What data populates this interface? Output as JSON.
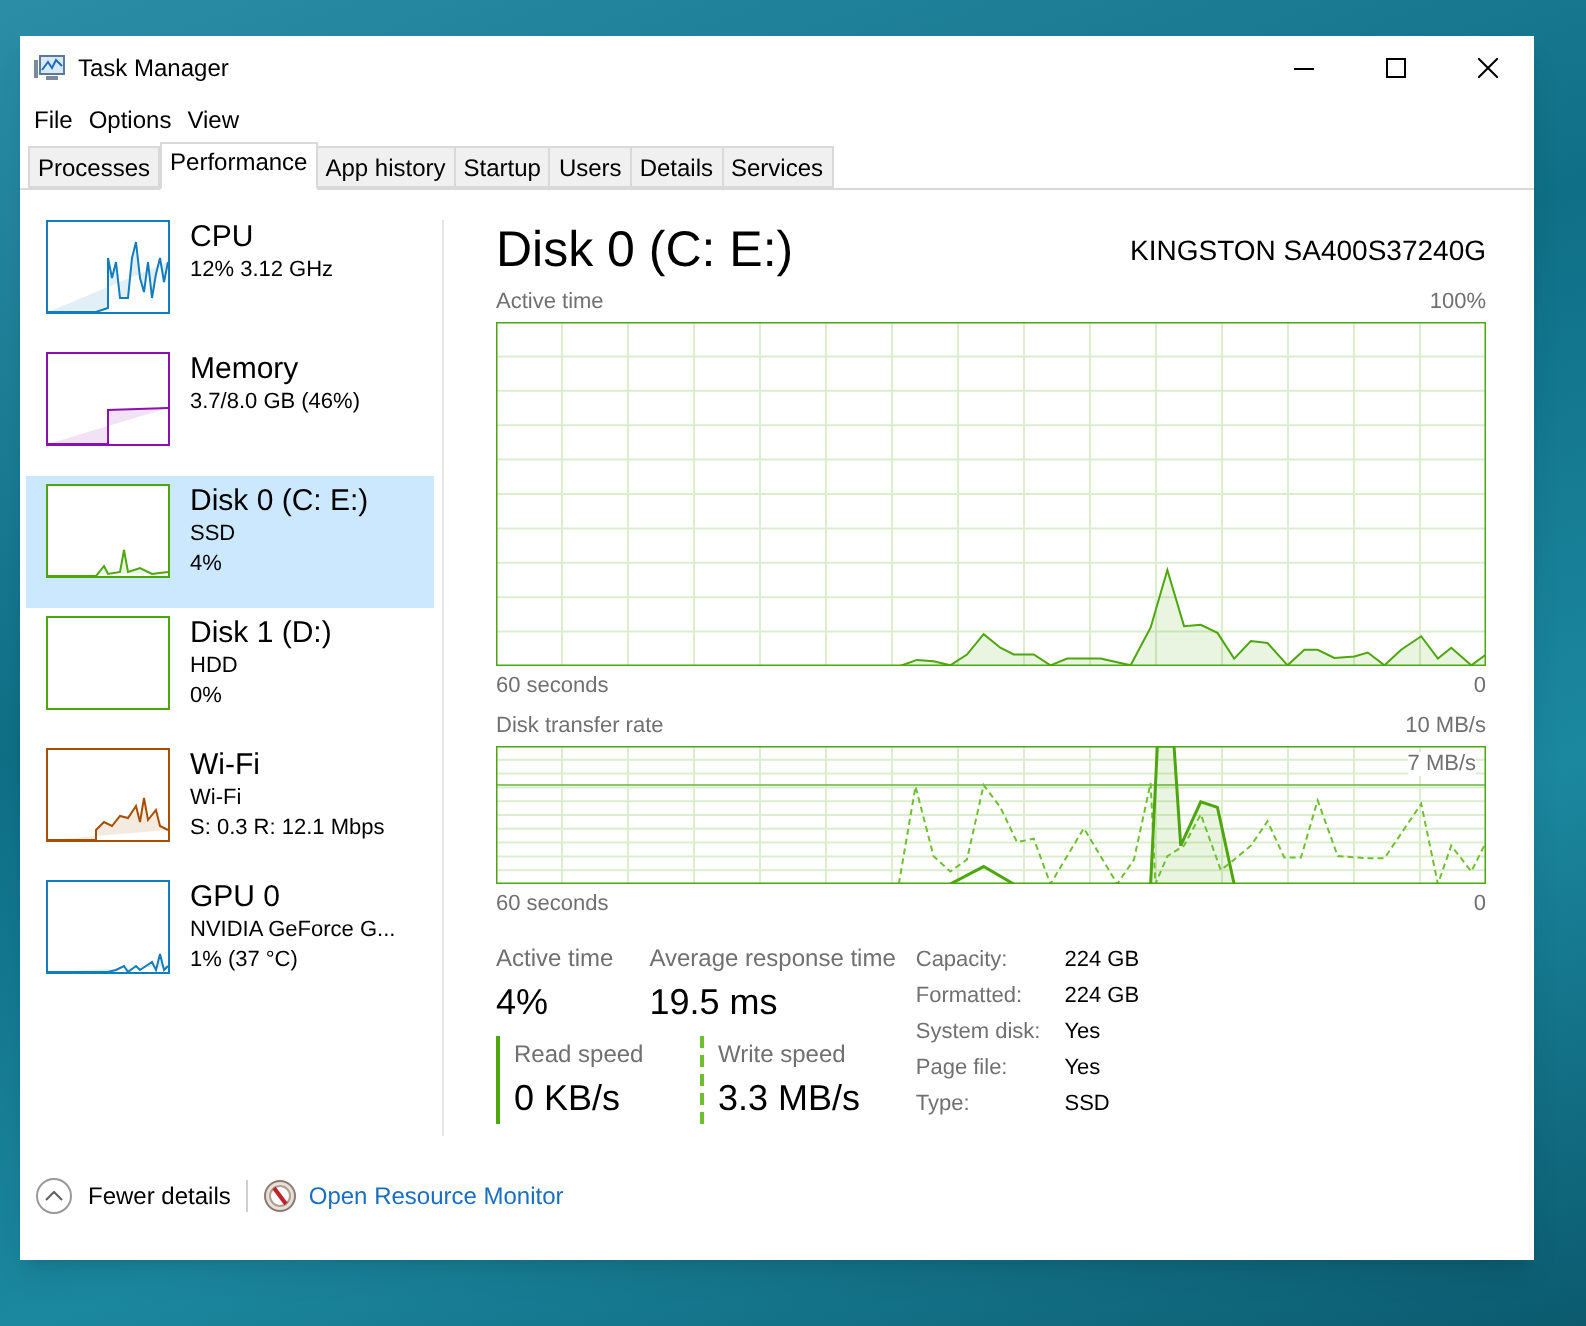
{
  "window": {
    "title": "Task Manager"
  },
  "menu": [
    "File",
    "Options",
    "View"
  ],
  "tabs": [
    {
      "label": "Processes",
      "selected": false
    },
    {
      "label": "Performance",
      "selected": true
    },
    {
      "label": "App history",
      "selected": false
    },
    {
      "label": "Startup",
      "selected": false
    },
    {
      "label": "Users",
      "selected": false
    },
    {
      "label": "Details",
      "selected": false
    },
    {
      "label": "Services",
      "selected": false
    }
  ],
  "sidebar": {
    "items": [
      {
        "name": "CPU",
        "details": [
          "12% 3.12 GHz"
        ],
        "color": "#117dbb",
        "selected": false
      },
      {
        "name": "Memory",
        "details": [
          "3.7/8.0 GB (46%)"
        ],
        "color": "#8b12ae",
        "selected": false
      },
      {
        "name": "Disk 0 (C: E:)",
        "details": [
          "SSD",
          "4%"
        ],
        "color": "#4da60c",
        "selected": true
      },
      {
        "name": "Disk 1 (D:)",
        "details": [
          "HDD",
          "0%"
        ],
        "color": "#4da60c",
        "selected": false
      },
      {
        "name": "Wi-Fi",
        "details": [
          "Wi-Fi",
          "S: 0.3 R: 12.1 Mbps"
        ],
        "color": "#a74f01",
        "selected": false
      },
      {
        "name": "GPU 0",
        "details": [
          "NVIDIA GeForce G...",
          "1% (37 °C)"
        ],
        "color": "#117dbb",
        "selected": false
      }
    ]
  },
  "disk": {
    "title": "Disk 0 (C: E:)",
    "model": "KINGSTON SA400S37240G",
    "active_chart": {
      "label": "Active time",
      "max": "100%",
      "span": "60 seconds",
      "end": "0"
    },
    "transfer_chart": {
      "label": "Disk transfer rate",
      "max": "10 MB/s",
      "marker": "7 MB/s",
      "span": "60 seconds",
      "end": "0"
    },
    "stats": [
      {
        "label": "Active time",
        "value": "4%"
      },
      {
        "label": "Average response time",
        "value": "19.5 ms"
      }
    ],
    "speeds": [
      {
        "label": "Read speed",
        "value": "0 KB/s",
        "kind": "solid"
      },
      {
        "label": "Write speed",
        "value": "3.3 MB/s",
        "kind": "dashed"
      }
    ],
    "properties": [
      {
        "label": "Capacity:",
        "value": "224 GB"
      },
      {
        "label": "Formatted:",
        "value": "224 GB"
      },
      {
        "label": "System disk:",
        "value": "Yes"
      },
      {
        "label": "Page file:",
        "value": "Yes"
      },
      {
        "label": "Type:",
        "value": "SSD"
      }
    ]
  },
  "footer": {
    "fewer_details": "Fewer details",
    "resource_monitor": "Open Resource Monitor"
  }
}
